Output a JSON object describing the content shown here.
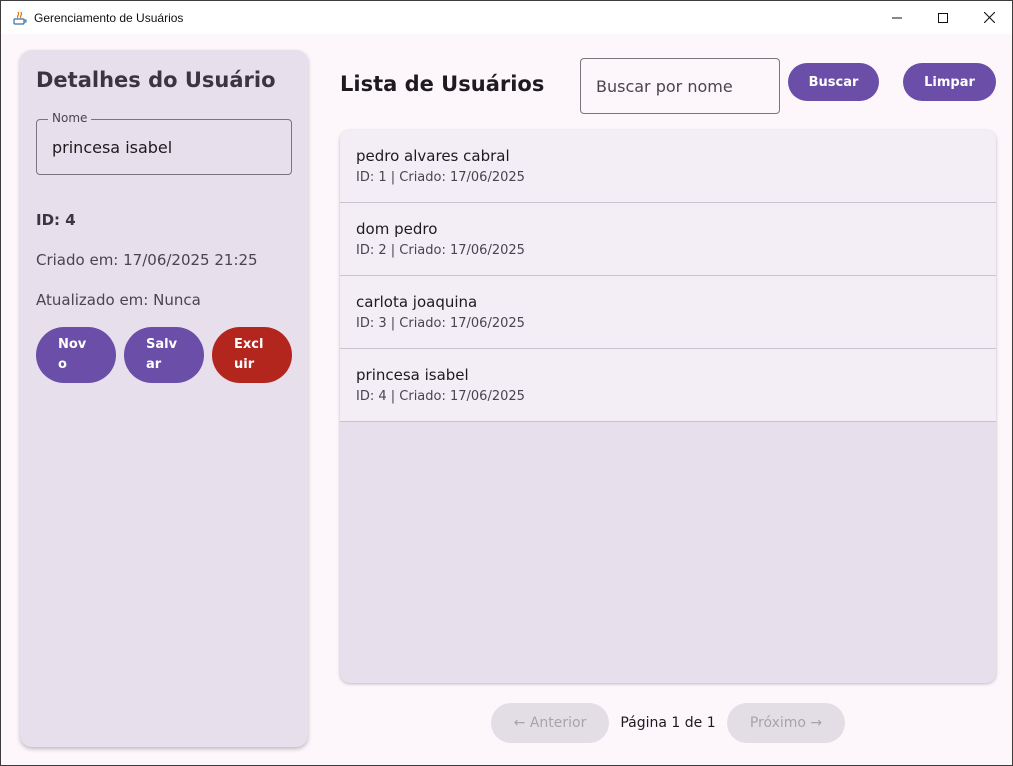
{
  "window": {
    "title": "Gerenciamento de Usuários",
    "controls": {
      "minimize": "minimize-icon",
      "maximize": "maximize-icon",
      "close": "close-icon"
    }
  },
  "details": {
    "title": "Detalhes do Usuário",
    "name_label": "Nome",
    "name_value": "princesa isabel",
    "id_text": "ID: 4",
    "created_text": "Criado em: 17/06/2025 21:25",
    "updated_text": "Atualizado em: Nunca",
    "buttons": {
      "new": "Novo",
      "save": "Salvar",
      "delete": "Excluir"
    }
  },
  "list": {
    "title": "Lista de Usuários",
    "search_placeholder": "Buscar por nome",
    "search_button": "Buscar",
    "clear_button": "Limpar",
    "items": [
      {
        "name": "pedro alvares cabral",
        "meta": "ID: 1 | Criado: 17/06/2025"
      },
      {
        "name": "dom pedro",
        "meta": "ID: 2 | Criado: 17/06/2025"
      },
      {
        "name": "carlota joaquina",
        "meta": "ID: 3 | Criado: 17/06/2025"
      },
      {
        "name": "princesa isabel",
        "meta": "ID: 4 | Criado: 17/06/2025"
      }
    ]
  },
  "pagination": {
    "previous": "← Anterior",
    "page_info": "Página 1 de 1",
    "next": "Próximo →"
  },
  "colors": {
    "primary": "#6a4ea8",
    "danger": "#b3261e",
    "card": "#e7dfeb",
    "background": "#fdf7fc"
  }
}
